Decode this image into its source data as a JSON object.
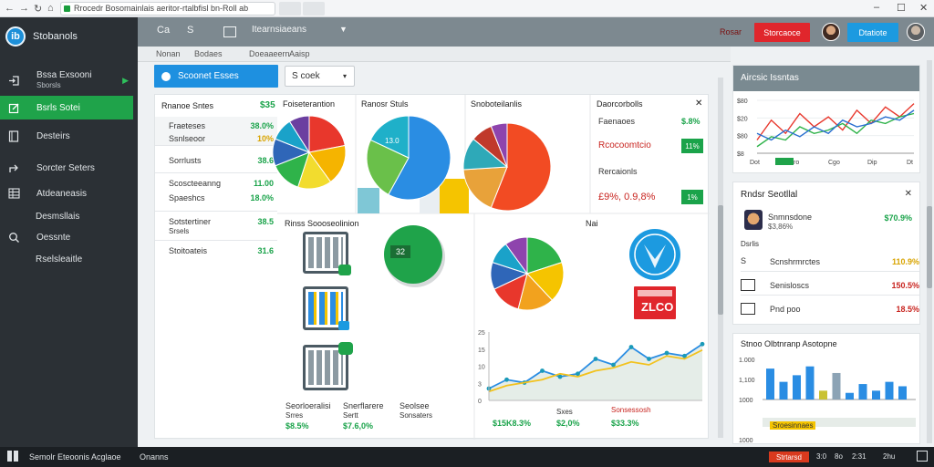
{
  "browser": {
    "url": "Rrocedr Bosomainlais aeritor-rtalbfisl bn-Roll ab",
    "back": "←",
    "forward": "→",
    "reload": "↻",
    "home": "⌂",
    "minimize": "–",
    "maximize": "☐",
    "close": "✕"
  },
  "brand": {
    "name": "Stobanols",
    "logo_text": "ib"
  },
  "sidebar": {
    "items": [
      {
        "label": "Bssa Exsooni",
        "sub": "Sborsls",
        "icon": "sign-in-icon"
      },
      {
        "label": "Bsrls Sotei",
        "icon": "edit-icon"
      },
      {
        "label": "Desteirs",
        "icon": "document-icon"
      },
      {
        "label": "Sorcter Seters",
        "icon": "share-icon"
      },
      {
        "label": "Atdeaneasis",
        "icon": "table-icon"
      },
      {
        "label": "Desmsllais"
      },
      {
        "label": "Oessnte",
        "icon": "search-icon"
      },
      {
        "label": "Rselsleaitle"
      }
    ]
  },
  "topbar": {
    "items": [
      "Ca",
      "S",
      "Itearnsiaeans",
      "▼"
    ],
    "link": "Rosar",
    "btn_red": "Storcaoce",
    "btn_blue": "Dtatiote"
  },
  "subtabs": [
    "Nonan",
    "Bodaes",
    "Doeaaeern",
    "Aaisp"
  ],
  "toolbar": {
    "report_btn": "Scoonet Esses",
    "select_value": "S coek",
    "select_caret": "▾"
  },
  "panel": {
    "list_header": "Rnanoe Sntes",
    "list_header_val": "$35",
    "list_rows": [
      {
        "label": "Fraeteses",
        "value": "38.0%",
        "yellow": false
      },
      {
        "label": "Ssnlseoor",
        "value": "10%",
        "yellow": true
      },
      {
        "label": "Sorrlusts",
        "value": "38.6",
        "yellow": false
      },
      {
        "label": "Scoscteeanng",
        "value": "11.00",
        "yellow": false
      },
      {
        "label": "Spaeshcs",
        "value": "18.0%",
        "yellow": false
      },
      {
        "label": "Sotstertiner",
        "sub": "Srsels",
        "value": "38.5",
        "yellow": false
      },
      {
        "label": "Stoitoateis",
        "value": "31.6",
        "yellow": false
      }
    ],
    "pie1_title": "Foiseterantion",
    "pie2_title": "Ranosr Stuls",
    "pie2_label": "13.0",
    "pie3_title": "Snoboteilanlis",
    "detail_title": "Daorcorbolls",
    "detail_close": "✕",
    "detail_rows": [
      {
        "label": "Faenaoes",
        "value": "$.8%"
      },
      {
        "label": "Rcocoomtcio",
        "value": "11%",
        "red": true
      },
      {
        "label": "Rercaionls"
      },
      {
        "label": "£9%, 0.9,8%",
        "value": "1%",
        "red": true
      }
    ],
    "lower_title": "Rinss Soooseolinion",
    "badge": "32",
    "lower_labels": [
      {
        "title": "Seorloeralisi",
        "sub": "Srres",
        "value": "$8.5%"
      },
      {
        "title": "Snerflarere",
        "sub": "Sertt",
        "value": "$7.6,0%"
      },
      {
        "title": "Seolsee",
        "sub": "Sonsaters",
        "value": ""
      }
    ],
    "right_title": "Nai",
    "red_box": "ZLCO",
    "bottom_vals": [
      "$15K8.3%",
      "$2,0%",
      "$33.3%"
    ],
    "bottom_labels": [
      "Sxes",
      "Sonsessosh"
    ],
    "chart_x": [
      "0",
      "3",
      "10",
      "15",
      "25"
    ]
  },
  "right1": {
    "title": "Aircsic Issntas",
    "y_ticks": [
      "$80",
      "$20",
      "$80",
      "$8"
    ],
    "x_ticks": [
      "Dot",
      "Dro",
      "Cgo",
      "Dip",
      "Dt"
    ]
  },
  "right2": {
    "title": "Rndsr Seotllal",
    "close": "✕",
    "top_row": {
      "label": "Snmnsdone",
      "sub": "$3,86%",
      "value": "$70.9%"
    },
    "section": "Dsrlis",
    "rows": [
      {
        "label": "Scnshrmrctes",
        "value": "110.9%",
        "color": "#d8a400",
        "icon": "s-icon"
      },
      {
        "label": "Senisloscs",
        "value": "150.5%",
        "color": "#c8241f",
        "icon": "chart-icon"
      },
      {
        "label": "Pnd poo",
        "value": "18.5%",
        "color": "#c8241f",
        "icon": "grid-icon"
      }
    ]
  },
  "right3": {
    "title": "Stnoo Olbtnranp Asotopne",
    "y_ticks": [
      "1.000",
      "1,100",
      "1000",
      "1000",
      "1000"
    ],
    "legend": "Sroesinnaes"
  },
  "taskbar": {
    "app": "Semolr Eteoonis Acglaoe",
    "item": "Onanns",
    "red": "Strtarsd",
    "right": [
      "3:0",
      "8o",
      "2:31",
      "2hu"
    ]
  },
  "chart_data": [
    {
      "type": "pie",
      "slices": [
        22,
        18,
        15,
        14,
        12,
        10,
        9
      ],
      "colors": [
        "#e8372c",
        "#f5b400",
        "#f2dc2e",
        "#2fb34a",
        "#2f66b8",
        "#1aa2c9",
        "#6b3fa0"
      ]
    },
    {
      "type": "pie",
      "title": "Ranosr Stuls",
      "slices": [
        58,
        24,
        18
      ],
      "colors": [
        "#2a8de3",
        "#6ac04a",
        "#1fb0c9"
      ]
    },
    {
      "type": "pie",
      "slices": [
        56,
        18,
        12,
        8,
        6
      ],
      "colors": [
        "#f24b23",
        "#e8a23a",
        "#2ea9b8",
        "#c0392b",
        "#8e44ad"
      ]
    },
    {
      "type": "pie",
      "slices": [
        20,
        18,
        16,
        14,
        12,
        10,
        10
      ],
      "colors": [
        "#2fb34a",
        "#f5c400",
        "#f2a21e",
        "#e8372c",
        "#2f66b8",
        "#1aa2c9",
        "#8e44ad"
      ]
    },
    {
      "type": "line",
      "x": [
        "0",
        "3",
        "10",
        "15",
        "25"
      ],
      "series": [
        {
          "values": [
            8,
            14,
            12,
            20,
            16,
            18,
            28,
            24,
            36,
            28,
            32,
            30,
            38
          ],
          "color": "#2a8de3"
        },
        {
          "values": [
            6,
            10,
            12,
            14,
            18,
            16,
            20,
            22,
            26,
            24,
            30,
            28,
            34
          ],
          "color": "#f2c21e"
        }
      ]
    },
    {
      "type": "line",
      "title": "Aircsic Issntas",
      "x": [
        "Dot",
        "Dro",
        "Cgo",
        "Dip",
        "Dt"
      ],
      "series": [
        {
          "values": [
            20,
            50,
            30,
            60,
            40,
            55,
            35,
            65,
            45,
            70,
            55,
            75
          ],
          "color": "#e8372c"
        },
        {
          "values": [
            10,
            25,
            20,
            40,
            30,
            35,
            45,
            30,
            50,
            45,
            55,
            60
          ],
          "color": "#2fb34a"
        },
        {
          "values": [
            30,
            20,
            35,
            25,
            40,
            30,
            50,
            40,
            45,
            55,
            50,
            65
          ],
          "color": "#2a6fd0"
        }
      ]
    },
    {
      "type": "bar",
      "title": "Stnoo Olbtnranp Asotopne",
      "values": [
        70,
        40,
        55,
        75,
        20,
        60,
        15,
        35,
        20,
        40,
        30
      ],
      "colors": [
        "#2a8de3",
        "#2a8de3",
        "#2a8de3",
        "#2a8de3",
        "#c9c233",
        "#8ca3b5",
        "#2a8de3",
        "#2a8de3",
        "#2a8de3",
        "#2a8de3",
        "#2a8de3"
      ]
    }
  ]
}
